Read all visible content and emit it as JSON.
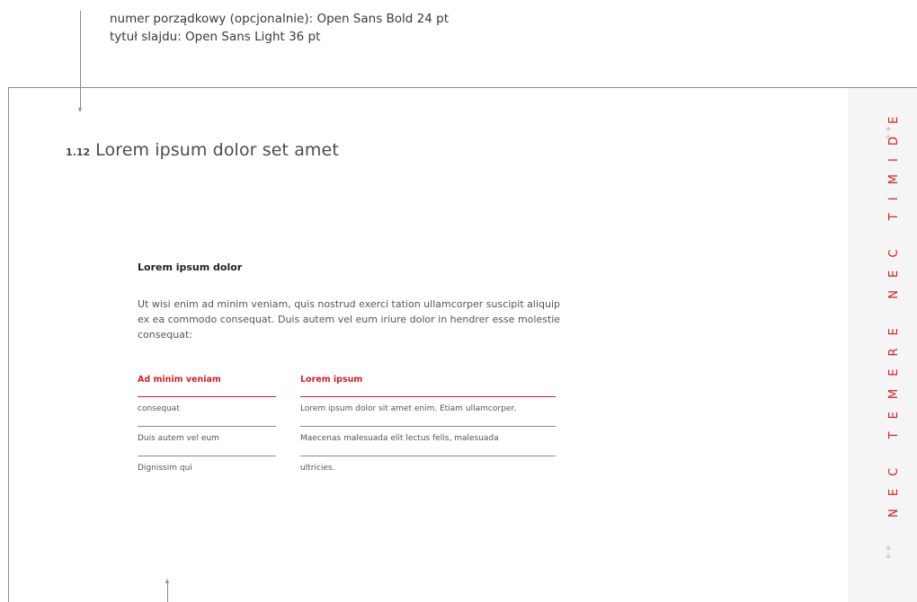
{
  "annotation": {
    "line1": "numer porządkowy (opcjonalnie): Open Sans Bold 24 pt",
    "line2": "tytuł slajdu: Open Sans Light 36 pt"
  },
  "slide": {
    "number": "1.12",
    "title": "Lorem ipsum dolor set amet",
    "heading": "Lorem ipsum dolor",
    "paragraph": "Ut wisi enim ad minim veniam, quis nostrud exerci tation ullamcorper suscipit aliquip ex ea commodo consequat. Duis autem vel eum iriure dolor in hendrer esse molestie consequat:",
    "table": {
      "headers": [
        "Ad minim veniam",
        "Lorem ipsum"
      ],
      "col1": [
        "consequat",
        "Duis autem vel eum",
        "Dignissim qui"
      ],
      "col2": [
        "Lorem ipsum dolor sit amet enim. Etiam ullamcorper.",
        "Maecenas malesuada elit lectus felis, malesuada",
        "ultricies."
      ]
    },
    "side_text": "NEC TEMERE NEC TIMIDE",
    "crosses": [
      "+",
      "+"
    ]
  },
  "colors": {
    "accent": "#d11f26",
    "rule": "#8c8c8c",
    "side_panel": "#f5f5f5"
  }
}
